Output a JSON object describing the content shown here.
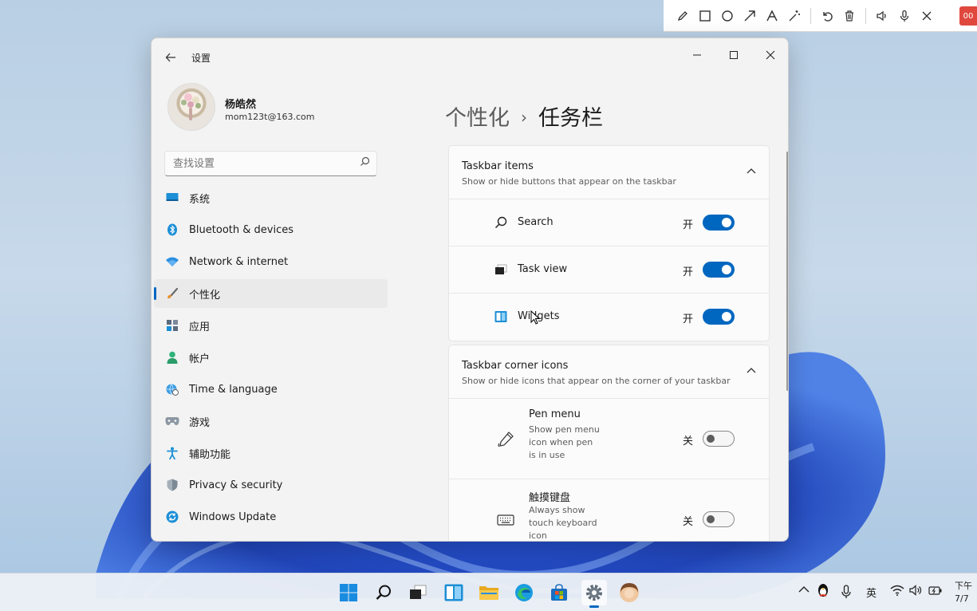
{
  "window": {
    "title": "设置",
    "back_icon": "arrow-left-icon",
    "minimize_icon": "minimize-icon",
    "maximize_icon": "maximize-icon",
    "close_icon": "close-icon"
  },
  "profile": {
    "name": "杨皓然",
    "email": "mom123t@163.com"
  },
  "search": {
    "placeholder": "查找设置"
  },
  "nav": {
    "items": [
      {
        "label": "系统",
        "icon": "monitor-icon"
      },
      {
        "label": "Bluetooth & devices",
        "icon": "bluetooth-icon"
      },
      {
        "label": "Network & internet",
        "icon": "wifi-icon"
      },
      {
        "label": "个性化",
        "icon": "brush-icon",
        "active": true
      },
      {
        "label": "应用",
        "icon": "apps-icon"
      },
      {
        "label": "帐户",
        "icon": "person-icon"
      },
      {
        "label": "Time & language",
        "icon": "globe-clock-icon"
      },
      {
        "label": "游戏",
        "icon": "gamepad-icon"
      },
      {
        "label": "辅助功能",
        "icon": "accessibility-icon"
      },
      {
        "label": "Privacy & security",
        "icon": "shield-icon"
      },
      {
        "label": "Windows Update",
        "icon": "update-icon"
      }
    ]
  },
  "breadcrumb": {
    "parent": "个性化",
    "separator": "›",
    "current": "任务栏"
  },
  "taskbar_items": {
    "title": "Taskbar items",
    "subtitle": "Show or hide buttons that appear on the taskbar",
    "rows": [
      {
        "label": "Search",
        "state": "开",
        "on": true,
        "icon": "search-icon"
      },
      {
        "label": "Task view",
        "state": "开",
        "on": true,
        "icon": "task-view-icon"
      },
      {
        "label": "Widgets",
        "state": "开",
        "on": true,
        "icon": "widgets-icon"
      }
    ]
  },
  "corner_icons": {
    "title": "Taskbar corner icons",
    "subtitle": "Show or hide icons that appear on the corner of your taskbar",
    "rows": [
      {
        "label": "Pen menu",
        "desc": "Show pen menu icon when pen is in use",
        "state": "关",
        "on": false,
        "icon": "pen-icon"
      },
      {
        "label": "触摸键盘",
        "desc": "Always show touch keyboard icon",
        "state": "关",
        "on": false,
        "icon": "keyboard-icon"
      }
    ]
  },
  "annotation_toolbar": {
    "record_label": "00"
  },
  "tray": {
    "ime": "英",
    "clock_line1": "下午",
    "clock_line2": "7/7"
  },
  "colors": {
    "accent": "#0067c0",
    "window_bg": "#f3f3f3",
    "card_bg": "#fbfbfb"
  }
}
